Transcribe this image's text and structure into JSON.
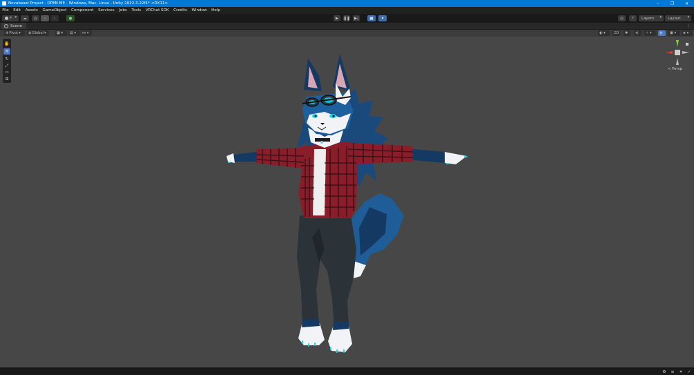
{
  "window": {
    "title": "Novabeast Project - OPEN ME - Windows, Mac, Linux - Unity 2022.3.22f1* <DX11>",
    "controls": [
      "–",
      "❐",
      "✕"
    ]
  },
  "menu": [
    "File",
    "Edit",
    "Assets",
    "GameObject",
    "Component",
    "Services",
    "Jobs",
    "Tools",
    "VRChat SDK",
    "Credits",
    "Window",
    "Help"
  ],
  "toolbar": {
    "account_label": "F",
    "play_icon": "play-icon",
    "pause_icon": "pause-icon",
    "step_icon": "step-icon",
    "layers_label": "Layers",
    "layout_label": "Layout"
  },
  "scene": {
    "tab_label": "Scene",
    "pivot_label": "Pivot",
    "global_label": "Global",
    "projection_label": "< Persp",
    "tools": [
      "hand-tool",
      "move-tool",
      "rotate-tool",
      "scale-tool",
      "rect-tool",
      "transform-tool"
    ]
  },
  "colors": {
    "titlebar": "#0078d4",
    "accent_active": "#3d6eaa",
    "viewport_bg": "#474747",
    "fur_dark": "#143a63",
    "fur_blue": "#1e5f9e",
    "fur_light": "#f1f3f6",
    "shirt_red": "#8a1d2a",
    "shirt_dark": "#2c1014",
    "jeans": "#2b3238",
    "claw_cyan": "#19d6e8"
  }
}
